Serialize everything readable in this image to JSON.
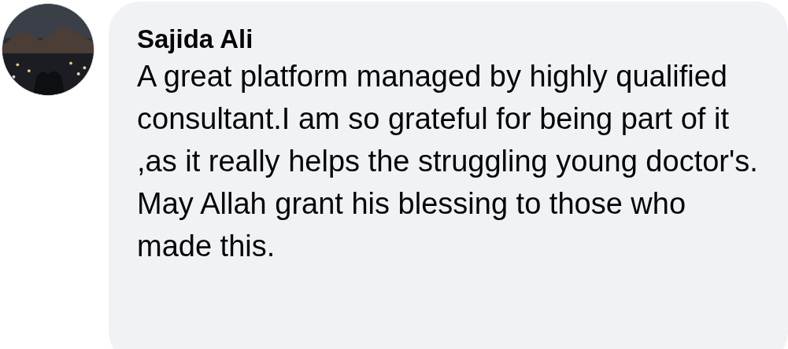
{
  "comment": {
    "author": "Sajida Ali",
    "text": "A great platform managed by highly qualified consultant.I am so grateful for being part of it ,as it really helps the struggling young doctor's. May Allah grant his blessing to those who made this."
  }
}
